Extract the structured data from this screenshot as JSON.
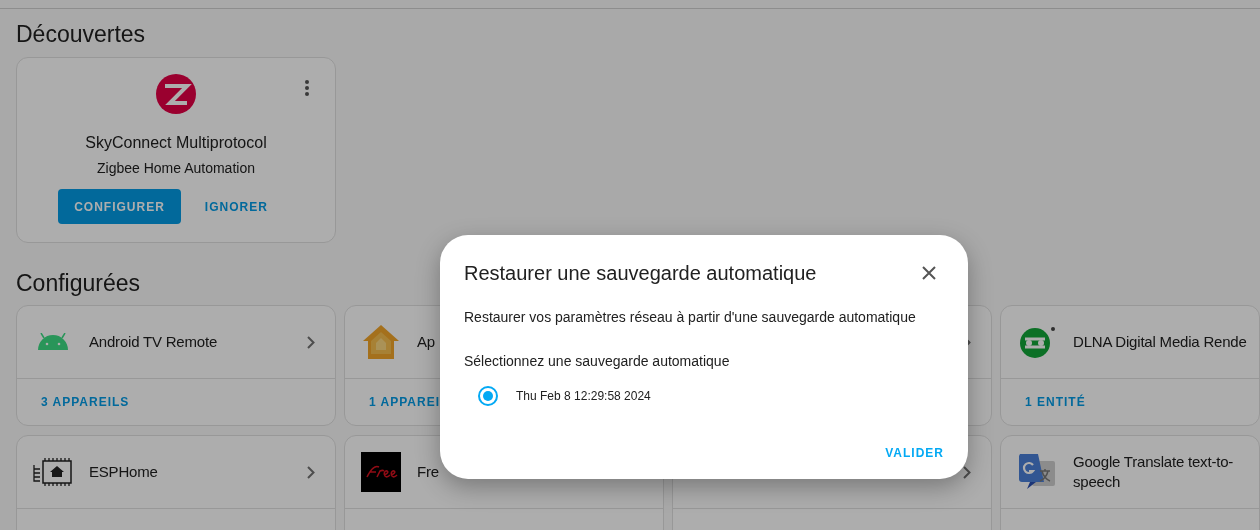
{
  "discovered": {
    "title": "Découvertes",
    "card": {
      "name": "SkyConnect Multiprotocol",
      "subtitle": "Zigbee Home Automation",
      "primary_button": "CONFIGURER",
      "secondary_button": "IGNORER"
    }
  },
  "configured": {
    "title": "Configurées",
    "cards": [
      {
        "kind": "android",
        "name": "Android TV Remote",
        "footer": "3 APPAREILS",
        "arrow": true
      },
      {
        "kind": "home",
        "name": "Ap",
        "footer": "1 APPAREI",
        "arrow": false
      },
      {
        "kind": "blank",
        "arrow": true
      },
      {
        "kind": "dlna",
        "name": "DLNA Digital Media Rende",
        "footer": "1 ENTITÉ",
        "arrow": false
      },
      {
        "kind": "chip",
        "name": "ESPHome",
        "arrow": true
      },
      {
        "kind": "free",
        "name": "Fre",
        "arrow": false
      },
      {
        "kind": "blank",
        "arrow": true
      },
      {
        "kind": "translate",
        "name": "Google Translate text-to-speech",
        "arrow": false
      }
    ]
  },
  "dialog": {
    "title": "Restaurer une sauvegarde automatique",
    "description": "Restaurer vos paramètres réseau à partir d'une sauvegarde automatique",
    "prompt": "Sélectionnez une sauvegarde automatique",
    "options": [
      {
        "label": "Thu Feb 8 12:29:58 2024",
        "selected": true
      }
    ],
    "button": "VALIDER"
  }
}
